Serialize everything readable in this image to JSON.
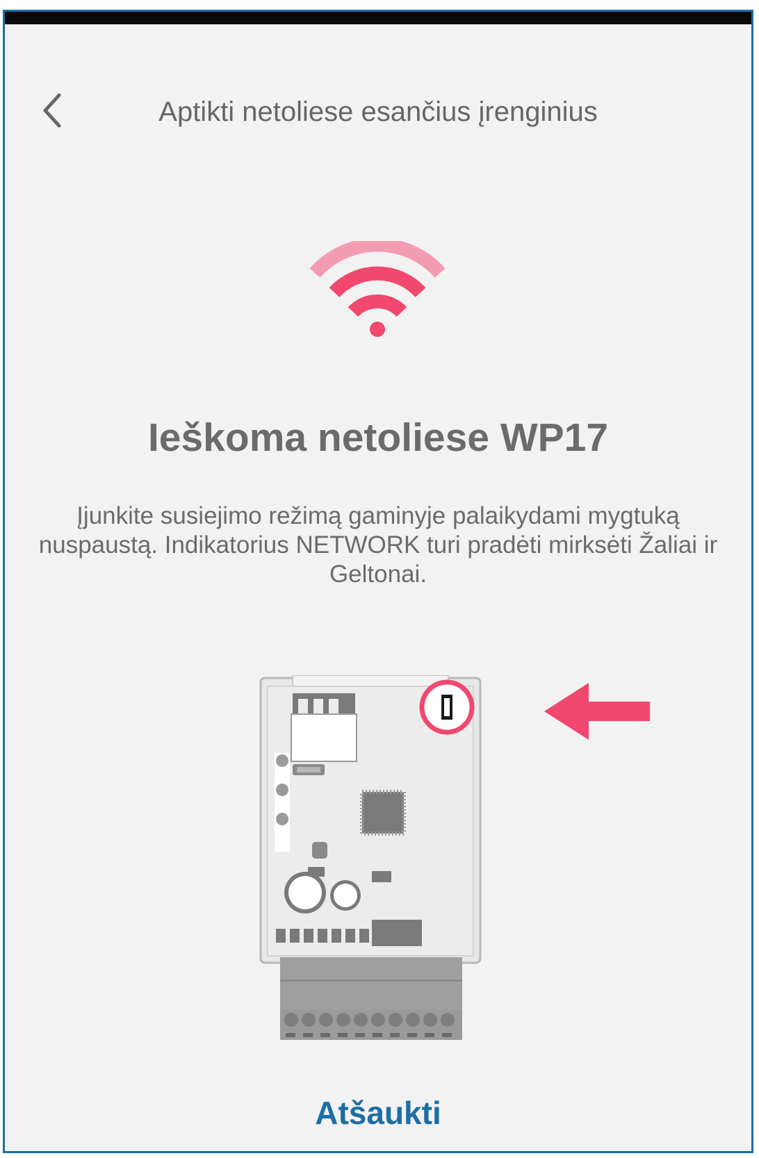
{
  "header": {
    "back_icon": "chevron-left-icon",
    "title": "Aptikti netoliese esančius įrenginius"
  },
  "search": {
    "icon": "wifi-icon",
    "headline": "Ieškoma netoliese WP17",
    "instructions": "Įjunkite susiejimo režimą gaminyje palaikydami mygtuką nuspaustą. Indikatorius NETWORK turi pradėti mirksėti Žaliai ir Geltonai."
  },
  "illustration": {
    "device": "controller-board-illustration",
    "pointer": "arrow-left-icon",
    "highlight": "pairing-button-highlight"
  },
  "footer": {
    "cancel_label": "Atšaukti"
  },
  "colors": {
    "accent_pink": "#f0486e",
    "light_pink": "#f39cb1",
    "link_blue": "#1c6ea4",
    "text_gray": "#6b6b6b",
    "background": "#f2f2f2"
  }
}
